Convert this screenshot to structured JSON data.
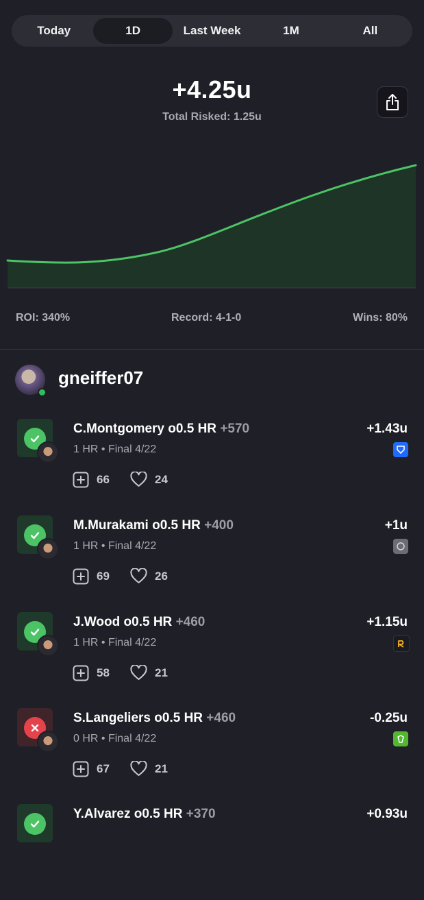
{
  "tabs": [
    "Today",
    "1D",
    "Last Week",
    "1M",
    "All"
  ],
  "active_tab": "1D",
  "summary": {
    "total": "+4.25u",
    "risked": "Total Risked: 1.25u"
  },
  "stats": {
    "roi": "ROI: 340%",
    "record": "Record: 4-1-0",
    "wins": "Wins: 80%"
  },
  "chart": {
    "line_color": "#4cc465"
  },
  "user": {
    "name": "gneiffer07"
  },
  "picks": [
    {
      "title": "C.Montgomery o0.5 HR",
      "odds": "+570",
      "sub": "1 HR • Final 4/22",
      "units": "+1.43u",
      "result": "win",
      "book": "fanduel",
      "book_color": "#1f6bff",
      "adds": "66",
      "likes": "24"
    },
    {
      "title": "M.Murakami o0.5 HR",
      "odds": "+400",
      "sub": "1 HR • Final 4/22",
      "units": "+1u",
      "result": "win",
      "book": "hard-rock",
      "book_color": "#6c6c74",
      "adds": "69",
      "likes": "26"
    },
    {
      "title": "J.Wood o0.5 HR",
      "odds": "+460",
      "sub": "1 HR • Final 4/22",
      "units": "+1.15u",
      "result": "win",
      "book": "rebet",
      "book_color": "#1a1a22",
      "adds": "58",
      "likes": "21"
    },
    {
      "title": "S.Langeliers o0.5 HR",
      "odds": "+460",
      "sub": "0 HR • Final 4/22",
      "units": "-0.25u",
      "result": "loss",
      "book": "draftkings",
      "book_color": "#53b82f",
      "adds": "67",
      "likes": "21"
    },
    {
      "title": "Y.Alvarez o0.5 HR",
      "odds": "+370",
      "sub": "",
      "units": "+0.93u",
      "result": "win",
      "book": "",
      "book_color": "",
      "adds": "",
      "likes": ""
    }
  ]
}
